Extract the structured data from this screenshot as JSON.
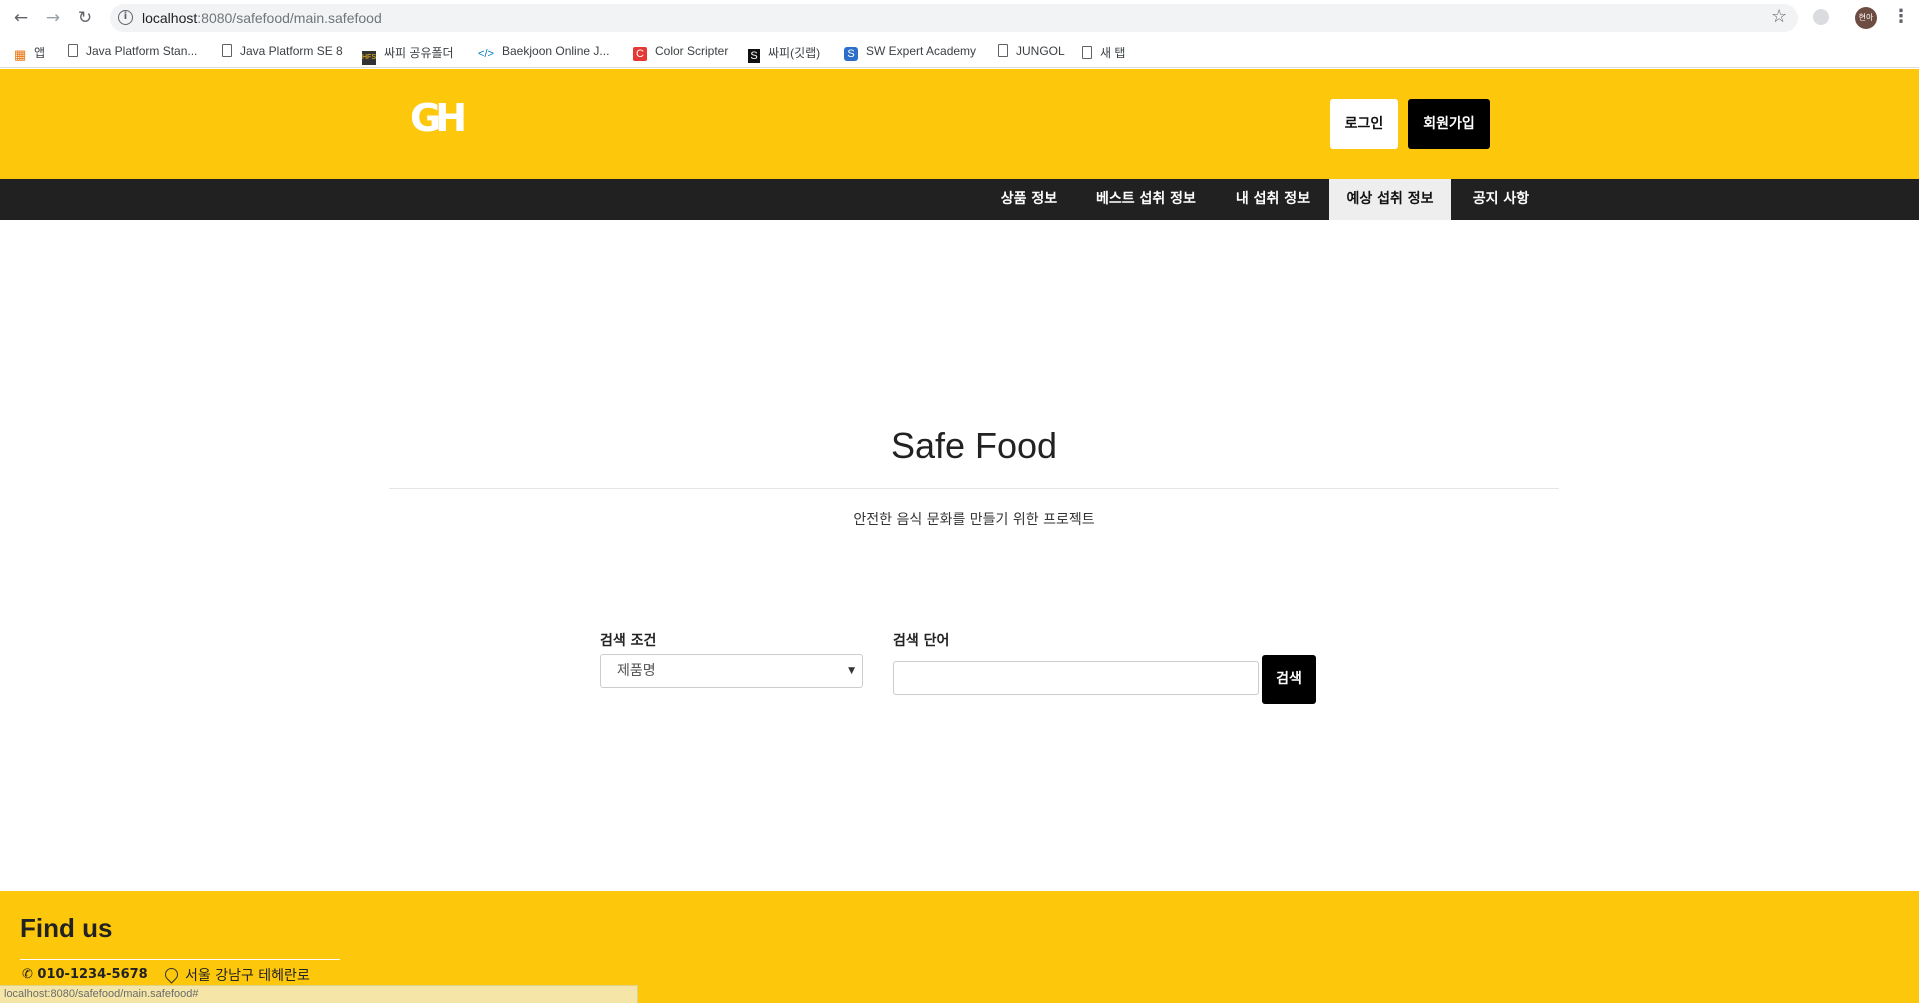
{
  "browser": {
    "url_host": "localhost",
    "url_rest": ":8080/safefood/main.safefood",
    "status_url": "localhost:8080/safefood/main.safefood#",
    "avatar_text": "현아",
    "bookmarks": [
      {
        "label": "앱",
        "icon": "apps-grid-icon"
      },
      {
        "label": "Java Platform Stan...",
        "icon": "page-icon"
      },
      {
        "label": "Java Platform SE 8",
        "icon": "page-icon"
      },
      {
        "label": "싸피 공유폴더",
        "icon": "hfs-icon"
      },
      {
        "label": "Baekjoon Online J...",
        "icon": "code-icon"
      },
      {
        "label": "Color Scripter",
        "icon": "color-scripter-icon"
      },
      {
        "label": "싸피(깃랩)",
        "icon": "gitlab-icon"
      },
      {
        "label": "SW Expert Academy",
        "icon": "swea-icon"
      },
      {
        "label": "JUNGOL",
        "icon": "page-icon"
      },
      {
        "label": "새 탭",
        "icon": "page-icon"
      }
    ]
  },
  "header": {
    "logo_text": "GH",
    "login_label": "로그인",
    "signup_label": "회원가입"
  },
  "nav": {
    "items": [
      {
        "label": "상품 정보"
      },
      {
        "label": "베스트 섭취 정보"
      },
      {
        "label": "내 섭취 정보"
      },
      {
        "label": "예상 섭취 정보",
        "active": true
      },
      {
        "label": "공지 사항"
      }
    ]
  },
  "hero": {
    "title": "Safe Food",
    "subtitle": "안전한 음식 문화를 만들기 위한 프로젝트"
  },
  "search": {
    "condition_label": "검색 조건",
    "condition_value": "제품명",
    "keyword_label": "검색 단어",
    "keyword_value": "",
    "button_label": "검색"
  },
  "footer": {
    "title": "Find us",
    "phone": "010-1234-5678",
    "address": "서울 강남구 테헤란로"
  },
  "colors": {
    "brand_yellow": "#fdc70c",
    "nav_dark": "#212121",
    "button_black": "#000000"
  }
}
